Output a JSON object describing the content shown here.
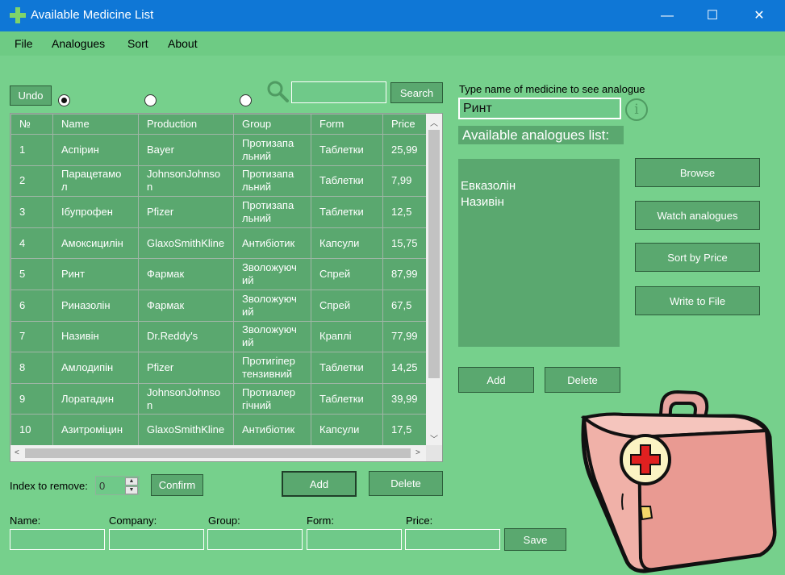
{
  "window": {
    "title": "Available Medicine List",
    "minimize": "—",
    "maximize": "☐",
    "close": "✕"
  },
  "menu": [
    "File",
    "Analogues",
    "Sort",
    "About"
  ],
  "toolbar": {
    "undo": "Undo",
    "search_button": "Search",
    "search_value": ""
  },
  "grid": {
    "columns": [
      "№",
      "Name",
      "Production",
      "Group",
      "Form",
      "Price"
    ],
    "rows": [
      [
        "1",
        "Аспірин",
        "Bayer",
        "Протизапа\nльний",
        "Таблетки",
        "25,99"
      ],
      [
        "2",
        "Парацетамо\nл",
        "JohnsonJohnso\nn",
        "Протизапа\nльний",
        "Таблетки",
        "7,99"
      ],
      [
        "3",
        "Ібупрофен",
        "Pfizer",
        "Протизапа\nльний",
        "Таблетки",
        "12,5"
      ],
      [
        "4",
        "Амоксицилін",
        "GlaxoSmithKline",
        "Антибіотик",
        "Капсули",
        "15,75"
      ],
      [
        "5",
        "Ринт",
        "Фармак",
        "Зволожуюч\nий",
        "Спрей",
        "87,99"
      ],
      [
        "6",
        "Риназолін",
        "Фармак",
        "Зволожуюч\nий",
        "Спрей",
        "67,5"
      ],
      [
        "7",
        "Називін",
        "Dr.Reddy's",
        "Зволожуюч\nий",
        "Краплі",
        "77,99"
      ],
      [
        "8",
        "Амлодипін",
        "Pfizer",
        "Протигіпер\nтензивний",
        "Таблетки",
        "14,25"
      ],
      [
        "9",
        "Лоратадин",
        "JohnsonJohnso\nn",
        "Протиалер\nгічний",
        "Таблетки",
        "39,99"
      ],
      [
        "10",
        "Азитроміцин",
        "GlaxoSmithKline",
        "Антибіотик",
        "Капсули",
        "17,5"
      ]
    ]
  },
  "remove": {
    "label": "Index to remove:",
    "value": "0",
    "confirm": "Confirm",
    "add": "Add",
    "delete": "Delete"
  },
  "form": {
    "name_label": "Name:",
    "company_label": "Company:",
    "group_label": "Group:",
    "form_label": "Form:",
    "price_label": "Price:",
    "save": "Save"
  },
  "analogues": {
    "prompt": "Type name of medicine to see analogue",
    "input_value": "Ринт",
    "info_glyph": "i",
    "list_title": "Available analogues list:",
    "items": [
      "Евказолін",
      "Називін"
    ],
    "browse": "Browse",
    "watch": "Watch analogues",
    "sort_price": "Sort by Price",
    "write_file": "Write to File",
    "add": "Add",
    "delete": "Delete"
  },
  "colors": {
    "titlebar": "#0f77d6",
    "background": "#76d08c",
    "control": "#5aa86f"
  }
}
